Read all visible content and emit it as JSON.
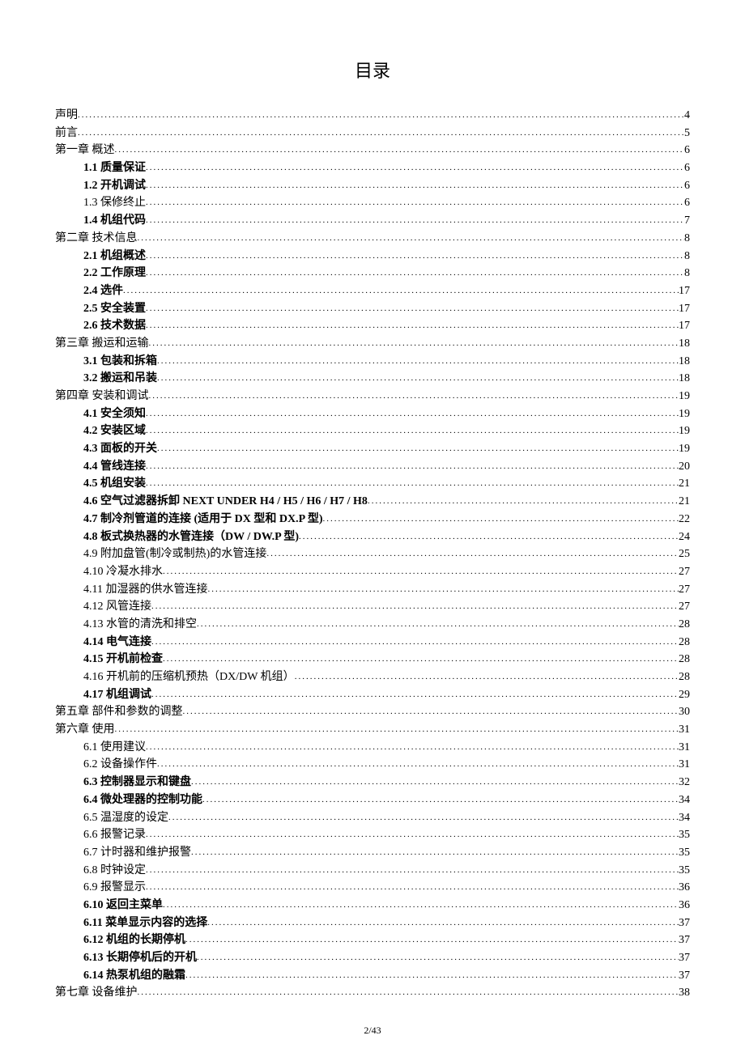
{
  "title": "目录",
  "footer": "2/43",
  "entries": [
    {
      "level": 0,
      "bold": false,
      "label": "声明 ",
      "page": "4"
    },
    {
      "level": 0,
      "bold": false,
      "label": "前言 ",
      "page": "5"
    },
    {
      "level": 0,
      "bold": false,
      "label": "第一章  概述 ",
      "page": "6"
    },
    {
      "level": 1,
      "bold": true,
      "label": "1.1 质量保证",
      "page": "6"
    },
    {
      "level": 1,
      "bold": true,
      "label": "1.2  开机调试",
      "page": "6"
    },
    {
      "level": 1,
      "bold": false,
      "label": "1.3 保修终止 ",
      "page": "6"
    },
    {
      "level": 1,
      "bold": true,
      "label": "1.4  机组代码",
      "page": "7"
    },
    {
      "level": 0,
      "bold": false,
      "label": "第二章  技术信息 ",
      "page": "8"
    },
    {
      "level": 1,
      "bold": true,
      "label": "2.1 机组概述",
      "page": "8"
    },
    {
      "level": 1,
      "bold": true,
      "label": "2.2  工作原理",
      "page": "8"
    },
    {
      "level": 1,
      "bold": true,
      "label": "2.4  选件 ",
      "page": "17"
    },
    {
      "level": 1,
      "bold": true,
      "label": "2.5  安全装置",
      "page": "17"
    },
    {
      "level": 1,
      "bold": true,
      "label": "2.6  技术数据",
      "page": "17"
    },
    {
      "level": 0,
      "bold": false,
      "label": "第三章 搬运和运输  ",
      "page": "18"
    },
    {
      "level": 1,
      "bold": true,
      "label": "3.1   包装和拆箱",
      "page": "18"
    },
    {
      "level": 1,
      "bold": true,
      "label": "3.2 搬运和吊装",
      "page": "18"
    },
    {
      "level": 0,
      "bold": false,
      "label": "第四章  安装和调试 ",
      "page": "19"
    },
    {
      "level": 1,
      "bold": true,
      "label": "4.1  安全须知",
      "page": "19"
    },
    {
      "level": 1,
      "bold": true,
      "label": "4.2  安装区域",
      "page": "19"
    },
    {
      "level": 1,
      "bold": true,
      "label": "4.3  面板的开关",
      "page": "19"
    },
    {
      "level": 1,
      "bold": true,
      "label": "4.4  管线连接",
      "page": "20"
    },
    {
      "level": 1,
      "bold": true,
      "label": "4.5  机组安装",
      "page": "21"
    },
    {
      "level": 1,
      "bold": true,
      "label": "4.6  空气过滤器拆卸  NEXT UNDER H4 / H5 / H6 / H7 / H8",
      "page": "21"
    },
    {
      "level": 1,
      "bold": true,
      "label": "4.7  制冷剂管道的连接 (适用于 DX 型和 DX.P 型)",
      "page": "22"
    },
    {
      "level": 1,
      "bold": true,
      "label": "4.8  板式换热器的水管连接（DW / DW.P 型)",
      "page": "24"
    },
    {
      "level": 1,
      "bold": false,
      "label": "4.9 附加盘管(制冷或制热)的水管连接",
      "page": "25"
    },
    {
      "level": 1,
      "bold": false,
      "label": "4.10 冷凝水排水 ",
      "page": "27"
    },
    {
      "level": 1,
      "bold": false,
      "label": "4.11 加湿器的供水管连接 ",
      "page": "27"
    },
    {
      "level": 1,
      "bold": false,
      "label": "4.12 风管连接 ",
      "page": "27"
    },
    {
      "level": 1,
      "bold": false,
      "label": "4.13 水管的清洗和排空 ",
      "page": "28"
    },
    {
      "level": 1,
      "bold": true,
      "label": "4.14  电气连接",
      "page": "28"
    },
    {
      "level": 1,
      "bold": true,
      "label": "4.15  开机前检查",
      "page": "28"
    },
    {
      "level": 1,
      "bold": false,
      "label": "4.16 开机前的压缩机预热（DX/DW 机组）",
      "page": "28"
    },
    {
      "level": 1,
      "bold": true,
      "label": "4.17  机组调试",
      "page": "29"
    },
    {
      "level": 0,
      "bold": false,
      "label": "第五章  部件和参数的调整 ",
      "page": "30"
    },
    {
      "level": 0,
      "bold": false,
      "label": "第六章  使用 ",
      "page": "31"
    },
    {
      "level": 1,
      "bold": false,
      "label": "6.1 使用建议 ",
      "page": "31"
    },
    {
      "level": 1,
      "bold": false,
      "label": "6.2 设备操作件 ",
      "page": "31"
    },
    {
      "level": 1,
      "bold": true,
      "label": "6.3  控制器显示和键盘",
      "page": "32"
    },
    {
      "level": 1,
      "bold": true,
      "label": "6.4  微处理器的控制功能",
      "page": "34"
    },
    {
      "level": 1,
      "bold": false,
      "label": "6.5 温湿度的设定 ",
      "page": "34"
    },
    {
      "level": 1,
      "bold": false,
      "label": "6.6 报警记录 ",
      "page": "35"
    },
    {
      "level": 1,
      "bold": false,
      "label": "6.7 计时器和维护报警",
      "page": "35"
    },
    {
      "level": 1,
      "bold": false,
      "label": "6.8 时钟设定 ",
      "page": "35"
    },
    {
      "level": 1,
      "bold": false,
      "label": "6.9 报警显示 ",
      "page": "36"
    },
    {
      "level": 1,
      "bold": true,
      "label": "6.10  返回主菜单",
      "page": "36"
    },
    {
      "level": 1,
      "bold": true,
      "label": "6.11   菜单显示内容的选择",
      "page": "37"
    },
    {
      "level": 1,
      "bold": true,
      "label": "6.12  机组的长期停机",
      "page": "37"
    },
    {
      "level": 1,
      "bold": true,
      "label": "6.13  长期停机后的开机",
      "page": "37"
    },
    {
      "level": 1,
      "bold": true,
      "label": "6.14  热泵机组的融霜",
      "page": "37"
    },
    {
      "level": 0,
      "bold": false,
      "label": "第七章  设备维护 ",
      "page": "38"
    }
  ]
}
